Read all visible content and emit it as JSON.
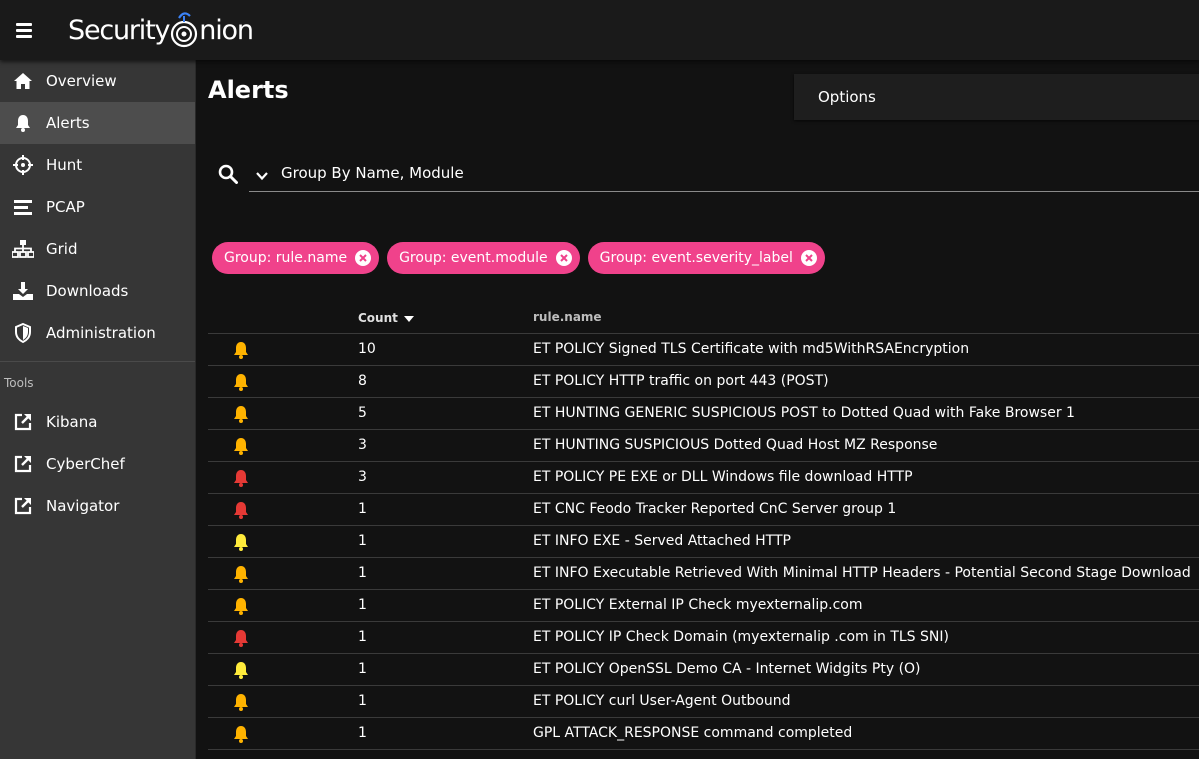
{
  "app": {
    "logo_text_left": "Security",
    "logo_text_right": "nion"
  },
  "sidebar": {
    "items": [
      {
        "label": "Overview",
        "icon": "home-icon",
        "active": false
      },
      {
        "label": "Alerts",
        "icon": "bell-icon",
        "active": true
      },
      {
        "label": "Hunt",
        "icon": "crosshair-icon",
        "active": false
      },
      {
        "label": "PCAP",
        "icon": "list-icon",
        "active": false
      },
      {
        "label": "Grid",
        "icon": "sitemap-icon",
        "active": false
      },
      {
        "label": "Downloads",
        "icon": "download-icon",
        "active": false
      },
      {
        "label": "Administration",
        "icon": "shield-icon",
        "active": false
      }
    ],
    "tools_header": "Tools",
    "tools": [
      {
        "label": "Kibana",
        "icon": "external-link-icon"
      },
      {
        "label": "CyberChef",
        "icon": "external-link-icon"
      },
      {
        "label": "Navigator",
        "icon": "external-link-icon"
      }
    ]
  },
  "main": {
    "title": "Alerts",
    "options_label": "Options",
    "search_value": "Group By Name, Module",
    "chips": [
      {
        "label": "Group: rule.name"
      },
      {
        "label": "Group: event.module"
      },
      {
        "label": "Group: event.severity_label"
      }
    ],
    "table": {
      "headers": {
        "count": "Count",
        "rule": "rule.name"
      },
      "colors": {
        "medium": "#ffb300",
        "high": "#e53935",
        "low": "#ffeb3b"
      },
      "rows": [
        {
          "severity": "medium",
          "count": "10",
          "rule": "ET POLICY Signed TLS Certificate with md5WithRSAEncryption"
        },
        {
          "severity": "medium",
          "count": "8",
          "rule": "ET POLICY HTTP traffic on port 443 (POST)"
        },
        {
          "severity": "medium",
          "count": "5",
          "rule": "ET HUNTING GENERIC SUSPICIOUS POST to Dotted Quad with Fake Browser 1"
        },
        {
          "severity": "medium",
          "count": "3",
          "rule": "ET HUNTING SUSPICIOUS Dotted Quad Host MZ Response"
        },
        {
          "severity": "high",
          "count": "3",
          "rule": "ET POLICY PE EXE or DLL Windows file download HTTP"
        },
        {
          "severity": "high",
          "count": "1",
          "rule": "ET CNC Feodo Tracker Reported CnC Server group 1"
        },
        {
          "severity": "low",
          "count": "1",
          "rule": "ET INFO EXE - Served Attached HTTP"
        },
        {
          "severity": "medium",
          "count": "1",
          "rule": "ET INFO Executable Retrieved With Minimal HTTP Headers - Potential Second Stage Download"
        },
        {
          "severity": "medium",
          "count": "1",
          "rule": "ET POLICY External IP Check myexternalip.com"
        },
        {
          "severity": "high",
          "count": "1",
          "rule": "ET POLICY IP Check Domain (myexternalip .com in TLS SNI)"
        },
        {
          "severity": "low",
          "count": "1",
          "rule": "ET POLICY OpenSSL Demo CA - Internet Widgits Pty (O)"
        },
        {
          "severity": "medium",
          "count": "1",
          "rule": "ET POLICY curl User-Agent Outbound"
        },
        {
          "severity": "medium",
          "count": "1",
          "rule": "GPL ATTACK_RESPONSE command completed"
        }
      ]
    }
  }
}
